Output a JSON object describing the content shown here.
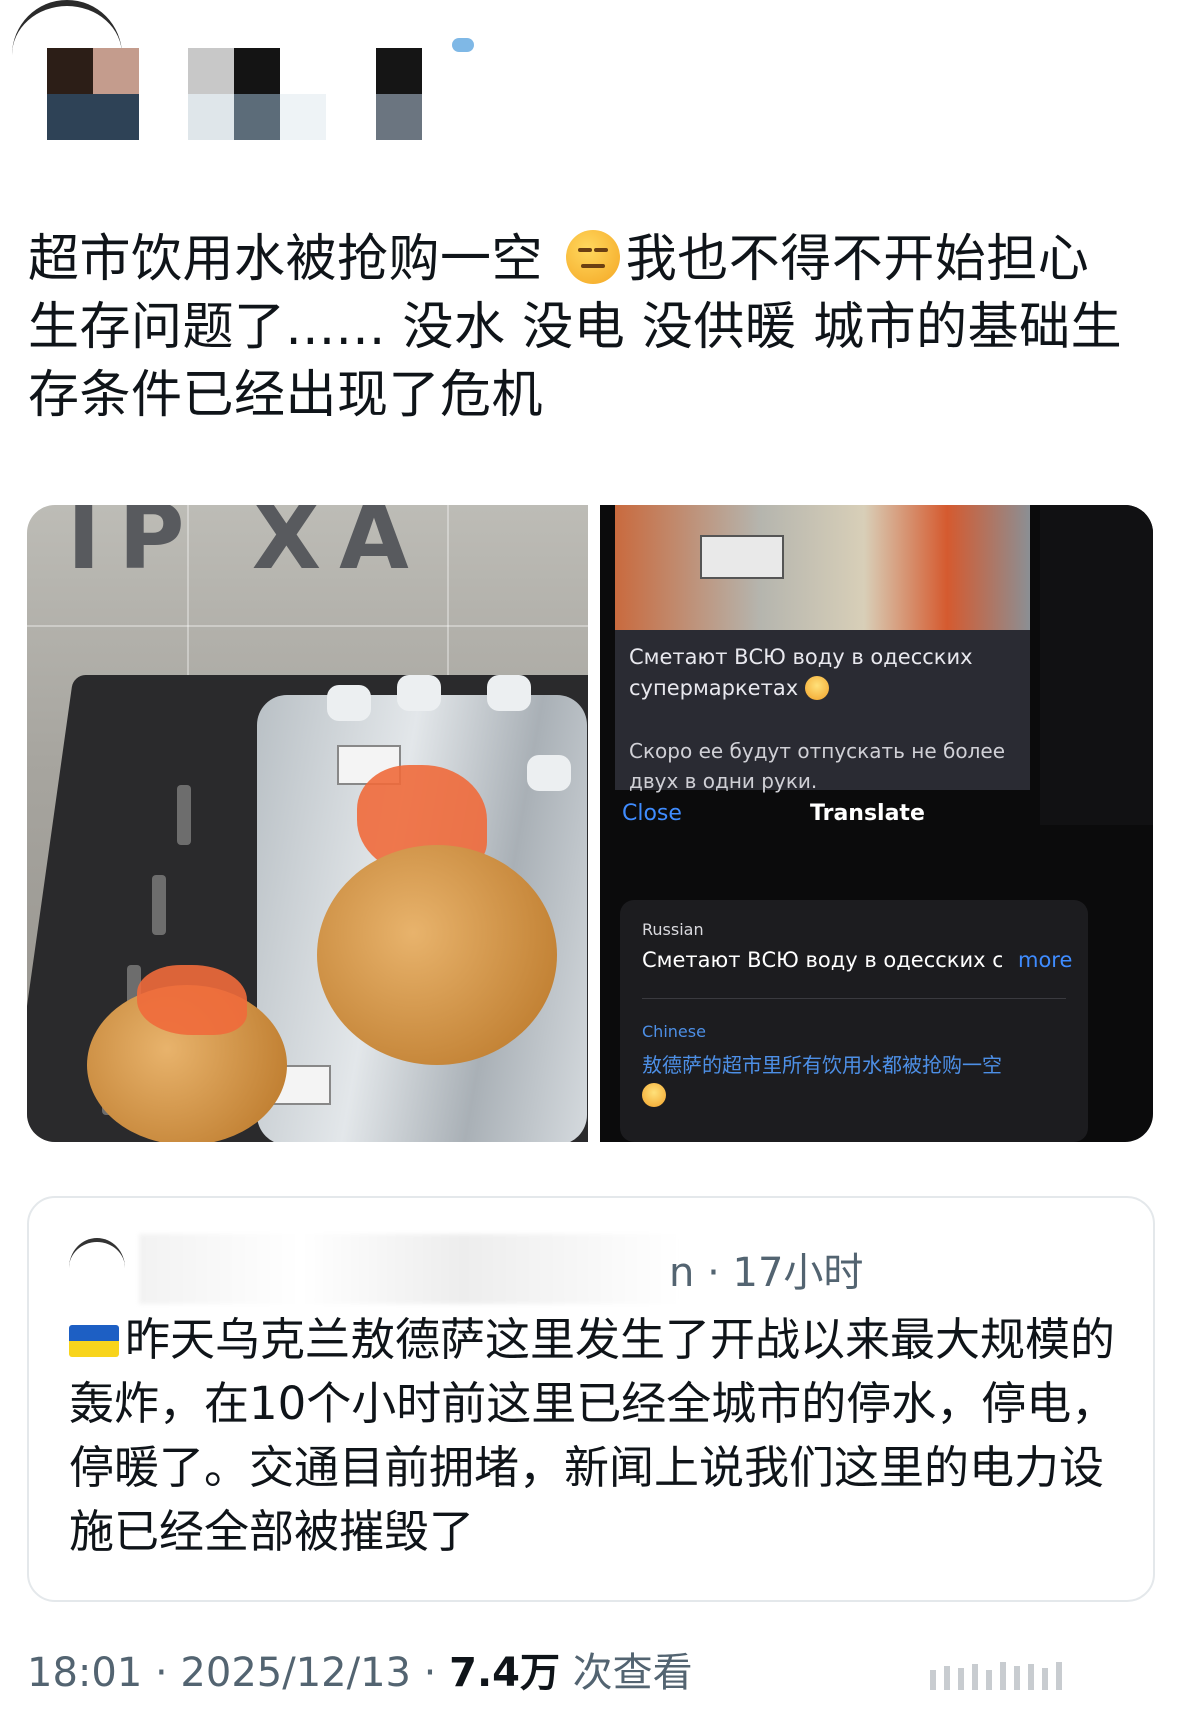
{
  "post": {
    "text_part1": "超市饮用水被抢购一空 ",
    "emoji_name": "expressionless-face-emoji",
    "text_part2": "我也不得不开始担心生存问题了...... 没水 没电 没供暖 城市的基础生存条件已经出现了危机"
  },
  "media": {
    "left_photo_sign": "IP XA",
    "right_screenshot": {
      "message_line1": "Сметают ВСЮ воду в одесских супермаркетах",
      "message_line2": "Скоро ее будут отпускать не более двух в одни руки.",
      "close_label": "Close",
      "translate_title": "Translate",
      "source_lang": "Russian",
      "source_text": "Сметают ВСЮ воду в одесских суп",
      "more_label": "more",
      "target_lang": "Chinese",
      "target_text": "敖德萨的超市里所有饮用水都被抢购一空"
    }
  },
  "quote": {
    "meta": "n · 17小时",
    "flag_icon": "ukraine-flag-icon",
    "text": "昨天乌克兰敖德萨这里发生了开战以来最大规模的轰炸，在10个小时前这里已经全城市的停水，停电，停暖了。交通目前拥堵，新闻上说我们这里的电力设施已经全部被摧毁了"
  },
  "footer": {
    "time_date": "18:01 · 2025/12/13 · ",
    "views_count": "7.4万",
    "views_label": " 次查看"
  },
  "colors": {
    "text_primary": "#0f1419",
    "text_secondary": "#536471",
    "link_blue": "#3f8cff",
    "border": "#e4e8eb"
  }
}
